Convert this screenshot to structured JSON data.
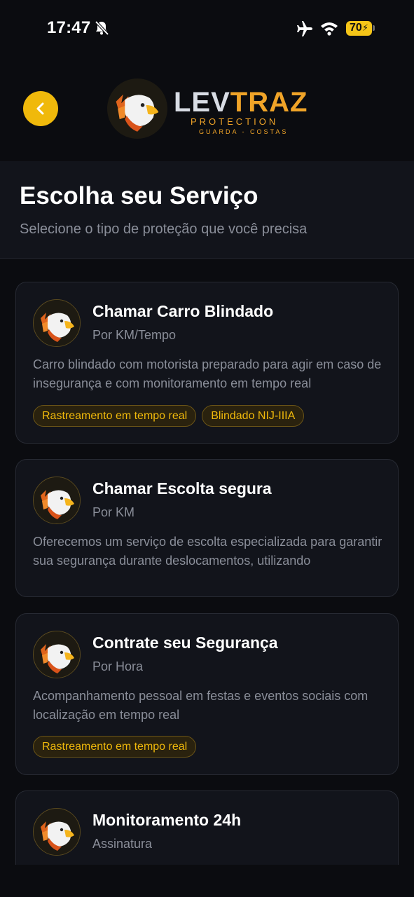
{
  "status_bar": {
    "time": "17:47",
    "battery": "70",
    "icons": [
      "bell-slash-icon",
      "airplane-icon",
      "wifi-icon",
      "battery-icon"
    ]
  },
  "header": {
    "back_icon": "chevron-left-icon",
    "logo": {
      "brand_part1": "LEV",
      "brand_part2": "TRAZ",
      "tagline": "PROTECTION",
      "sub_tagline": "GUARDA - COSTAS"
    }
  },
  "page": {
    "title": "Escolha seu Serviço",
    "subtitle": "Selecione o tipo de proteção que você precisa"
  },
  "services": [
    {
      "title": "Chamar Carro Blindado",
      "pricing": "Por KM/Tempo",
      "description": "Carro blindado com motorista preparado para agir  em caso de insegurança e com monitoramento em tempo real",
      "tags": [
        "Rastreamento em tempo real",
        "Blindado NIJ-IIIA"
      ]
    },
    {
      "title": "Chamar Escolta segura",
      "pricing": "Por KM",
      "description": "Oferecemos um serviço de escolta especializada para garantir sua segurança durante deslocamentos, utilizando",
      "tags": []
    },
    {
      "title": "Contrate seu Segurança",
      "pricing": "Por Hora",
      "description": "Acompanhamento pessoal em festas e eventos sociais com localização em tempo real",
      "tags": [
        "Rastreamento em tempo real"
      ]
    },
    {
      "title": "Monitoramento 24h",
      "pricing": "Assinatura",
      "description": "",
      "tags": []
    }
  ],
  "colors": {
    "accent": "#f0b90b",
    "background": "#0b0c10",
    "card": "#12141b",
    "muted_text": "#8a8e99"
  }
}
